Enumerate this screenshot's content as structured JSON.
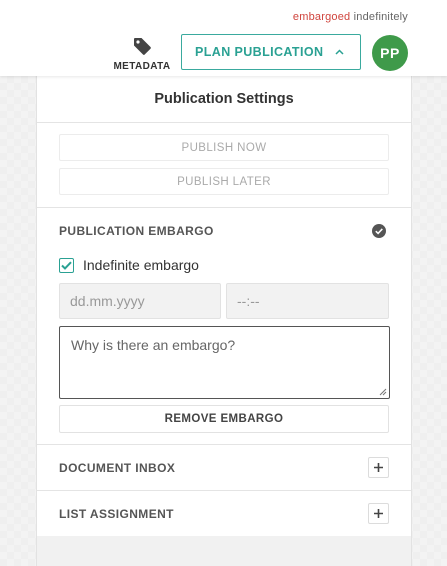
{
  "header": {
    "status_highlight": "embargoed",
    "status_rest": "indefinitely",
    "metadata_label": "METADATA",
    "metadata_icon": "tag-icon",
    "plan_button_label": "PLAN PUBLICATION",
    "plan_button_icon": "chevron-up-icon",
    "avatar_initials": "PP"
  },
  "panel": {
    "title": "Publication Settings",
    "publish_now_label": "PUBLISH NOW",
    "publish_later_label": "PUBLISH LATER",
    "embargo": {
      "title": "PUBLICATION EMBARGO",
      "status_icon": "check-circle-icon",
      "indefinite_label": "Indefinite embargo",
      "indefinite_checked": true,
      "date_placeholder": "dd.mm.yyyy",
      "time_placeholder": "--:--",
      "reason_placeholder": "Why is there an embargo?",
      "remove_label": "REMOVE EMBARGO"
    },
    "document_inbox_label": "DOCUMENT INBOX",
    "list_assignment_label": "LIST ASSIGNMENT"
  },
  "colors": {
    "accent": "#2aa193",
    "embargoed": "#d0453e",
    "avatar_bg": "#3f9a4a"
  }
}
